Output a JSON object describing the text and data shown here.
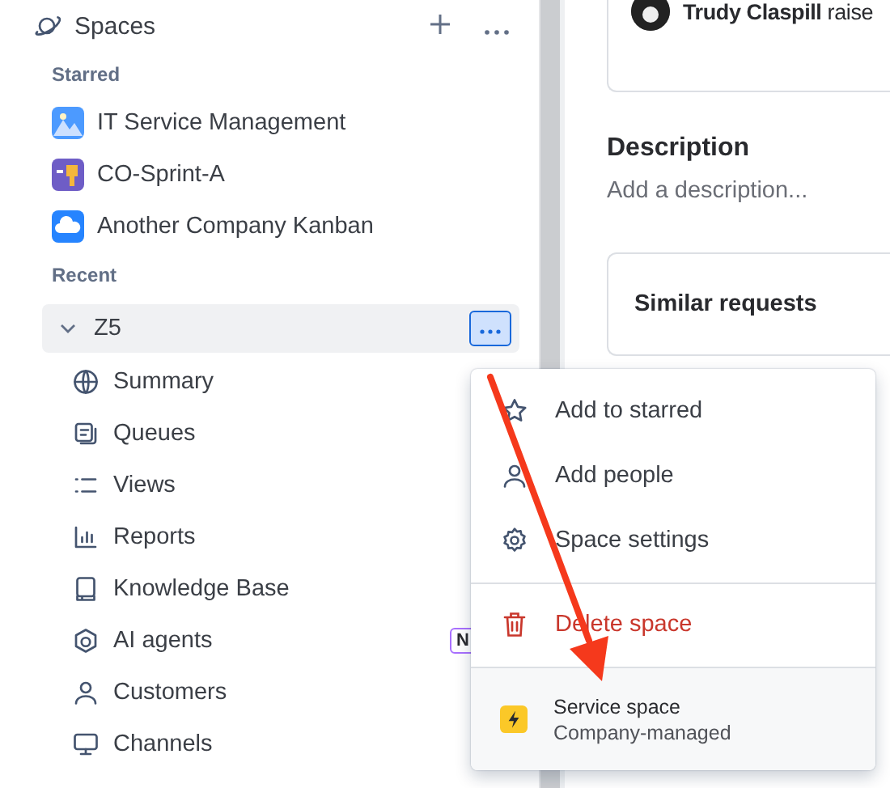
{
  "sidebar": {
    "title": "Spaces",
    "sections": [
      {
        "label": "Starred",
        "items": [
          {
            "name": "IT Service Management"
          },
          {
            "name": "CO-Sprint-A"
          },
          {
            "name": "Another Company Kanban"
          }
        ]
      },
      {
        "label": "Recent",
        "space": {
          "name": "Z5",
          "expanded": true,
          "menu_open": true,
          "children": [
            {
              "name": "Summary"
            },
            {
              "name": "Queues"
            },
            {
              "name": "Views"
            },
            {
              "name": "Reports"
            },
            {
              "name": "Knowledge Base"
            },
            {
              "name": "AI agents",
              "badge": "N"
            },
            {
              "name": "Customers"
            },
            {
              "name": "Channels"
            }
          ]
        }
      }
    ]
  },
  "menu": {
    "items": [
      {
        "kind": "action",
        "label": "Add to starred"
      },
      {
        "kind": "action",
        "label": "Add people"
      },
      {
        "kind": "action",
        "label": "Space settings"
      },
      {
        "kind": "danger",
        "label": "Delete space"
      },
      {
        "kind": "space",
        "label": "Service space",
        "subtitle": "Company-managed"
      }
    ]
  },
  "main": {
    "activity": "**Trudy Claspill** raise",
    "description": {
      "title": "Description",
      "placeholder": "Add a description..."
    },
    "similar": {
      "title": "Similar requests"
    }
  }
}
